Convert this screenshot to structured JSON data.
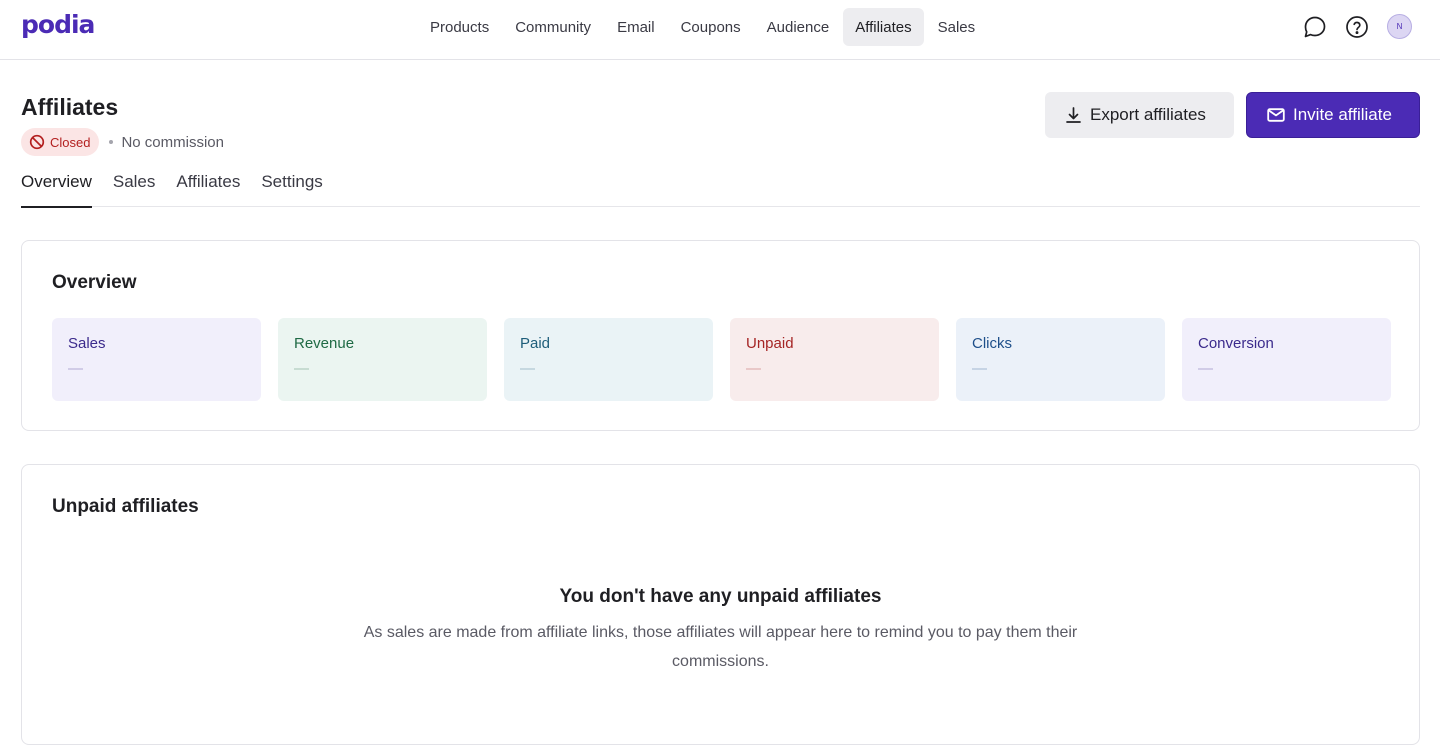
{
  "brand": {
    "logo": "podia",
    "accent": "#4b2bb5"
  },
  "nav": {
    "items": [
      {
        "label": "Products",
        "active": false
      },
      {
        "label": "Community",
        "active": false
      },
      {
        "label": "Email",
        "active": false
      },
      {
        "label": "Coupons",
        "active": false
      },
      {
        "label": "Audience",
        "active": false
      },
      {
        "label": "Affiliates",
        "active": true
      },
      {
        "label": "Sales",
        "active": false
      }
    ],
    "icons": [
      "chat-icon",
      "help-icon"
    ],
    "avatar_initial": "N"
  },
  "header": {
    "title": "Affiliates",
    "status_badge": "Closed",
    "commission": "No commission",
    "export_label": "Export affiliates",
    "invite_label": "Invite affiliate"
  },
  "tabs": [
    {
      "label": "Overview",
      "active": true
    },
    {
      "label": "Sales",
      "active": false
    },
    {
      "label": "Affiliates",
      "active": false
    },
    {
      "label": "Settings",
      "active": false
    }
  ],
  "overview": {
    "title": "Overview",
    "stats": [
      {
        "label": "Sales",
        "value": "—",
        "bg": "#f1effb",
        "fg": "#3b2a8c"
      },
      {
        "label": "Revenue",
        "value": "—",
        "bg": "#ebf5f1",
        "fg": "#1f6a45"
      },
      {
        "label": "Paid",
        "value": "—",
        "bg": "#eaf3f6",
        "fg": "#1e5d7a"
      },
      {
        "label": "Unpaid",
        "value": "—",
        "bg": "#f8ecec",
        "fg": "#a52424"
      },
      {
        "label": "Clicks",
        "value": "—",
        "bg": "#ebf1f9",
        "fg": "#1e4f8a"
      },
      {
        "label": "Conversion",
        "value": "—",
        "bg": "#f1effb",
        "fg": "#3b2a8c"
      }
    ]
  },
  "unpaid": {
    "title": "Unpaid affiliates",
    "empty_title": "You don't have any unpaid affiliates",
    "empty_desc": "As sales are made from affiliate links, those affiliates will appear here to remind you to pay them their commissions."
  }
}
